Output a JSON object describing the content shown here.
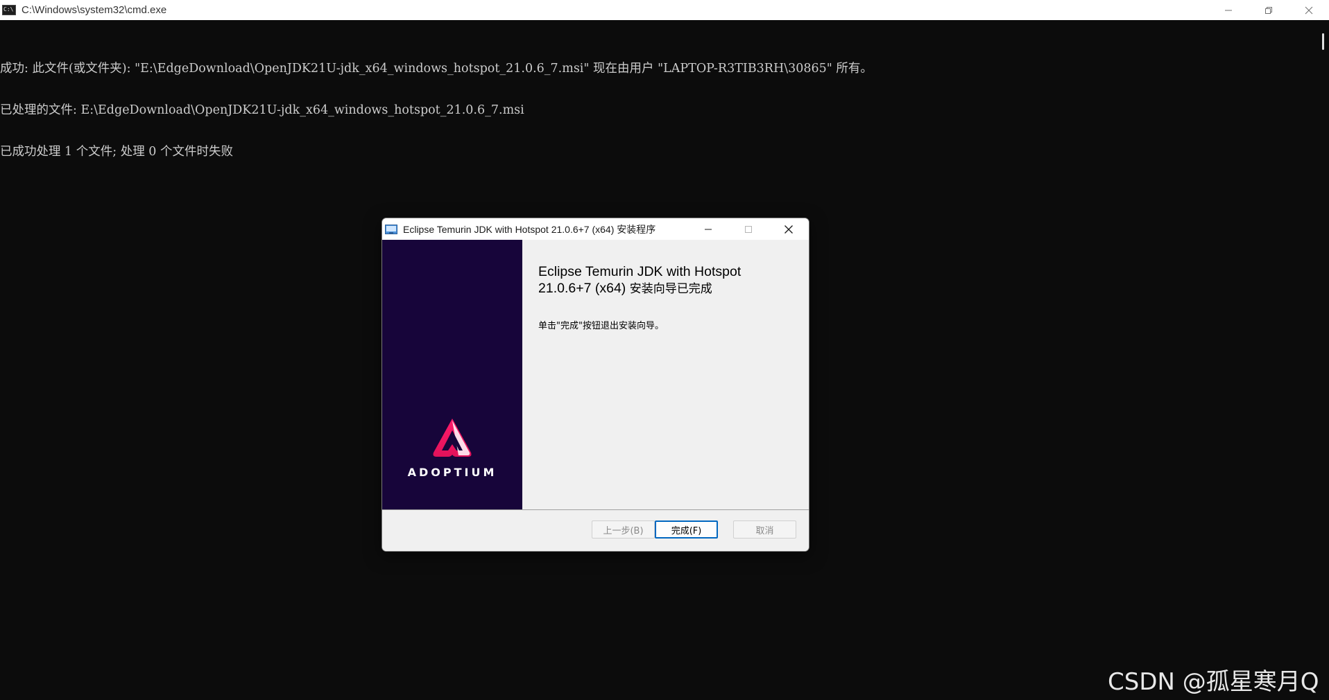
{
  "window": {
    "title": "C:\\Windows\\system32\\cmd.exe"
  },
  "console": {
    "lines": [
      "成功: 此文件(或文件夹): \"E:\\EdgeDownload\\OpenJDK21U-jdk_x64_windows_hotspot_21.0.6_7.msi\" 现在由用户 \"LAPTOP-R3TIB3RH\\30865\" 所有。",
      "已处理的文件: E:\\EdgeDownload\\OpenJDK21U-jdk_x64_windows_hotspot_21.0.6_7.msi",
      "已成功处理 1 个文件; 处理 0 个文件时失败"
    ]
  },
  "dialog": {
    "title": "Eclipse Temurin JDK with Hotspot 21.0.6+7 (x64) 安装程序",
    "heading_line1": "Eclipse Temurin JDK with Hotspot",
    "heading_line2": "21.0.6+7 (x64)",
    "heading_suffix": "安装向导已完成",
    "message": "单击\"完成\"按钮退出安装向导。",
    "logo_text": "ADOPTIUM",
    "buttons": {
      "back": "上一步(B)",
      "finish": "完成(F)",
      "cancel": "取消"
    }
  },
  "watermark": "CSDN @孤星寒月Q",
  "colors": {
    "console_bg": "#0c0c0c",
    "console_text": "#cccccc",
    "sidebar_bg": "#17053a",
    "logo_pink": "#ff1464",
    "accent_blue": "#0067c0"
  }
}
